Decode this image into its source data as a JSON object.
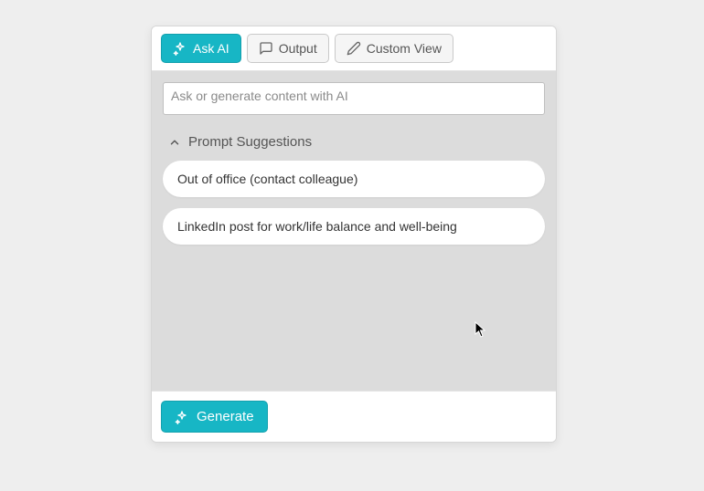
{
  "tabs": {
    "ask_ai": "Ask AI",
    "output": "Output",
    "custom_view": "Custom View"
  },
  "input": {
    "placeholder": "Ask or generate content with AI"
  },
  "suggestions": {
    "header": "Prompt Suggestions",
    "items": [
      "Out of office (contact colleague)",
      "LinkedIn post for work/life balance and well-being"
    ]
  },
  "buttons": {
    "generate": "Generate"
  },
  "colors": {
    "accent": "#17b6c5"
  }
}
